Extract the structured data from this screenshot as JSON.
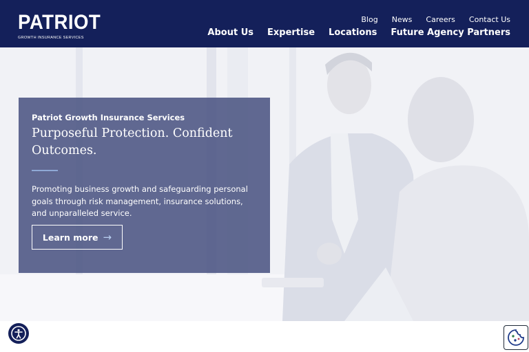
{
  "brand": {
    "logo_word": "PATRIOT",
    "logo_tagline": "GROWTH INSURANCE SERVICES"
  },
  "utility_nav": [
    {
      "label": "Blog"
    },
    {
      "label": "News"
    },
    {
      "label": "Careers"
    },
    {
      "label": "Contact Us"
    }
  ],
  "main_nav": [
    {
      "label": "About Us"
    },
    {
      "label": "Expertise"
    },
    {
      "label": "Locations"
    },
    {
      "label": "Future Agency Partners"
    }
  ],
  "hero": {
    "eyebrow": "Patriot Growth Insurance Services",
    "headline": "Purposeful Protection. Confident Outcomes.",
    "body": "Promoting business growth and safeguarding personal goals through risk management, insurance solutions, and unparalleled service.",
    "cta_label": "Learn more",
    "cta_icon": "arrow-right-icon"
  },
  "widgets": {
    "accessibility_icon": "accessibility-icon",
    "cookie_icon": "cookie-icon"
  },
  "colors": {
    "header_bg": "#14205a",
    "card_bg": "#485280",
    "accent_rule": "#8fa9d6"
  }
}
